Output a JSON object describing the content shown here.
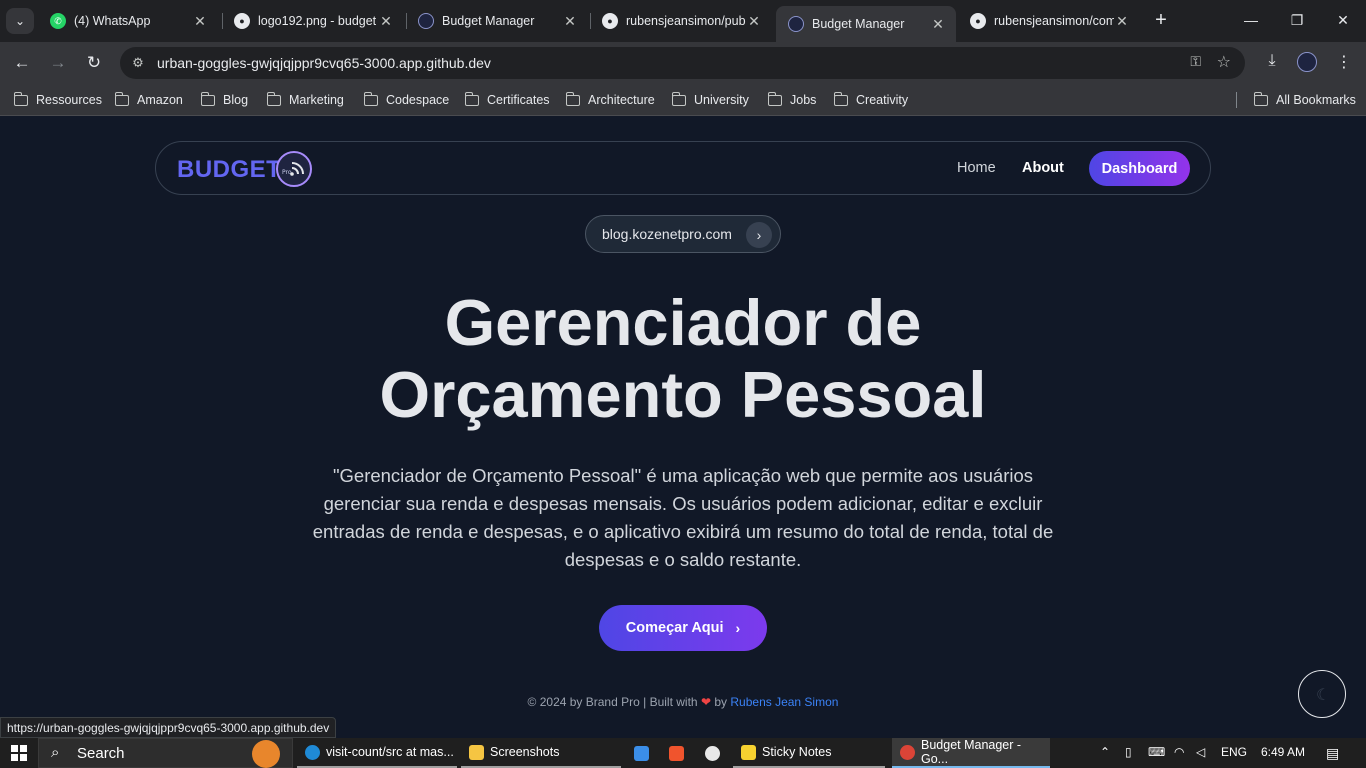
{
  "browser": {
    "tabs": [
      {
        "title": "(4) WhatsApp",
        "icon": "whatsapp-icon"
      },
      {
        "title": "logo192.png - budget",
        "icon": "github-icon"
      },
      {
        "title": "Budget Manager",
        "icon": "budget-pro-icon"
      },
      {
        "title": "rubensjeansimon/pub",
        "icon": "github-icon"
      },
      {
        "title": "Budget Manager",
        "icon": "budget-pro-icon",
        "active": true
      },
      {
        "title": "rubensjeansimon/com",
        "icon": "github-icon"
      }
    ],
    "url": "urban-goggles-gwjqjqjppr9cvq65-3000.app.github.dev",
    "bookmarks": [
      "Ressources",
      "Amazon",
      "Blog",
      "Marketing",
      "Codespace",
      "Certificates",
      "Architecture",
      "University",
      "Jobs",
      "Creativity"
    ],
    "all_bookmarks": "All Bookmarks",
    "status_url": "https://urban-goggles-gwjqjqjppr9cvq65-3000.app.github.dev"
  },
  "page": {
    "brand": "BUDGET",
    "brand_logo_text": "Pro",
    "nav": {
      "home": "Home",
      "about": "About",
      "dashboard": "Dashboard"
    },
    "pill": "blog.kozenetpro.com",
    "title_line1": "Gerenciador de",
    "title_line2": "Orçamento Pessoal",
    "description": "\"Gerenciador de Orçamento Pessoal\" é uma aplicação web que permite aos usuários gerenciar sua renda e despesas mensais. Os usuários podem adicionar, editar e excluir entradas de renda e despesas, e o aplicativo exibirá um resumo do total de renda, total de despesas e o saldo restante.",
    "cta": "Começar Aqui",
    "footer_prefix": "© 2024 by Brand Pro | Built with",
    "footer_by": "by",
    "footer_author": "Rubens Jean Simon"
  },
  "taskbar": {
    "search": "Search",
    "items": [
      "visit-count/src at mas...",
      "Screenshots",
      "Sticky Notes",
      "Budget Manager - Go..."
    ],
    "language": "ENG",
    "time": "6:49 AM"
  },
  "colors": {
    "accent": "#6366f1",
    "gradient_start": "#4f46e5",
    "gradient_end": "#9333ea",
    "background": "#111827"
  }
}
